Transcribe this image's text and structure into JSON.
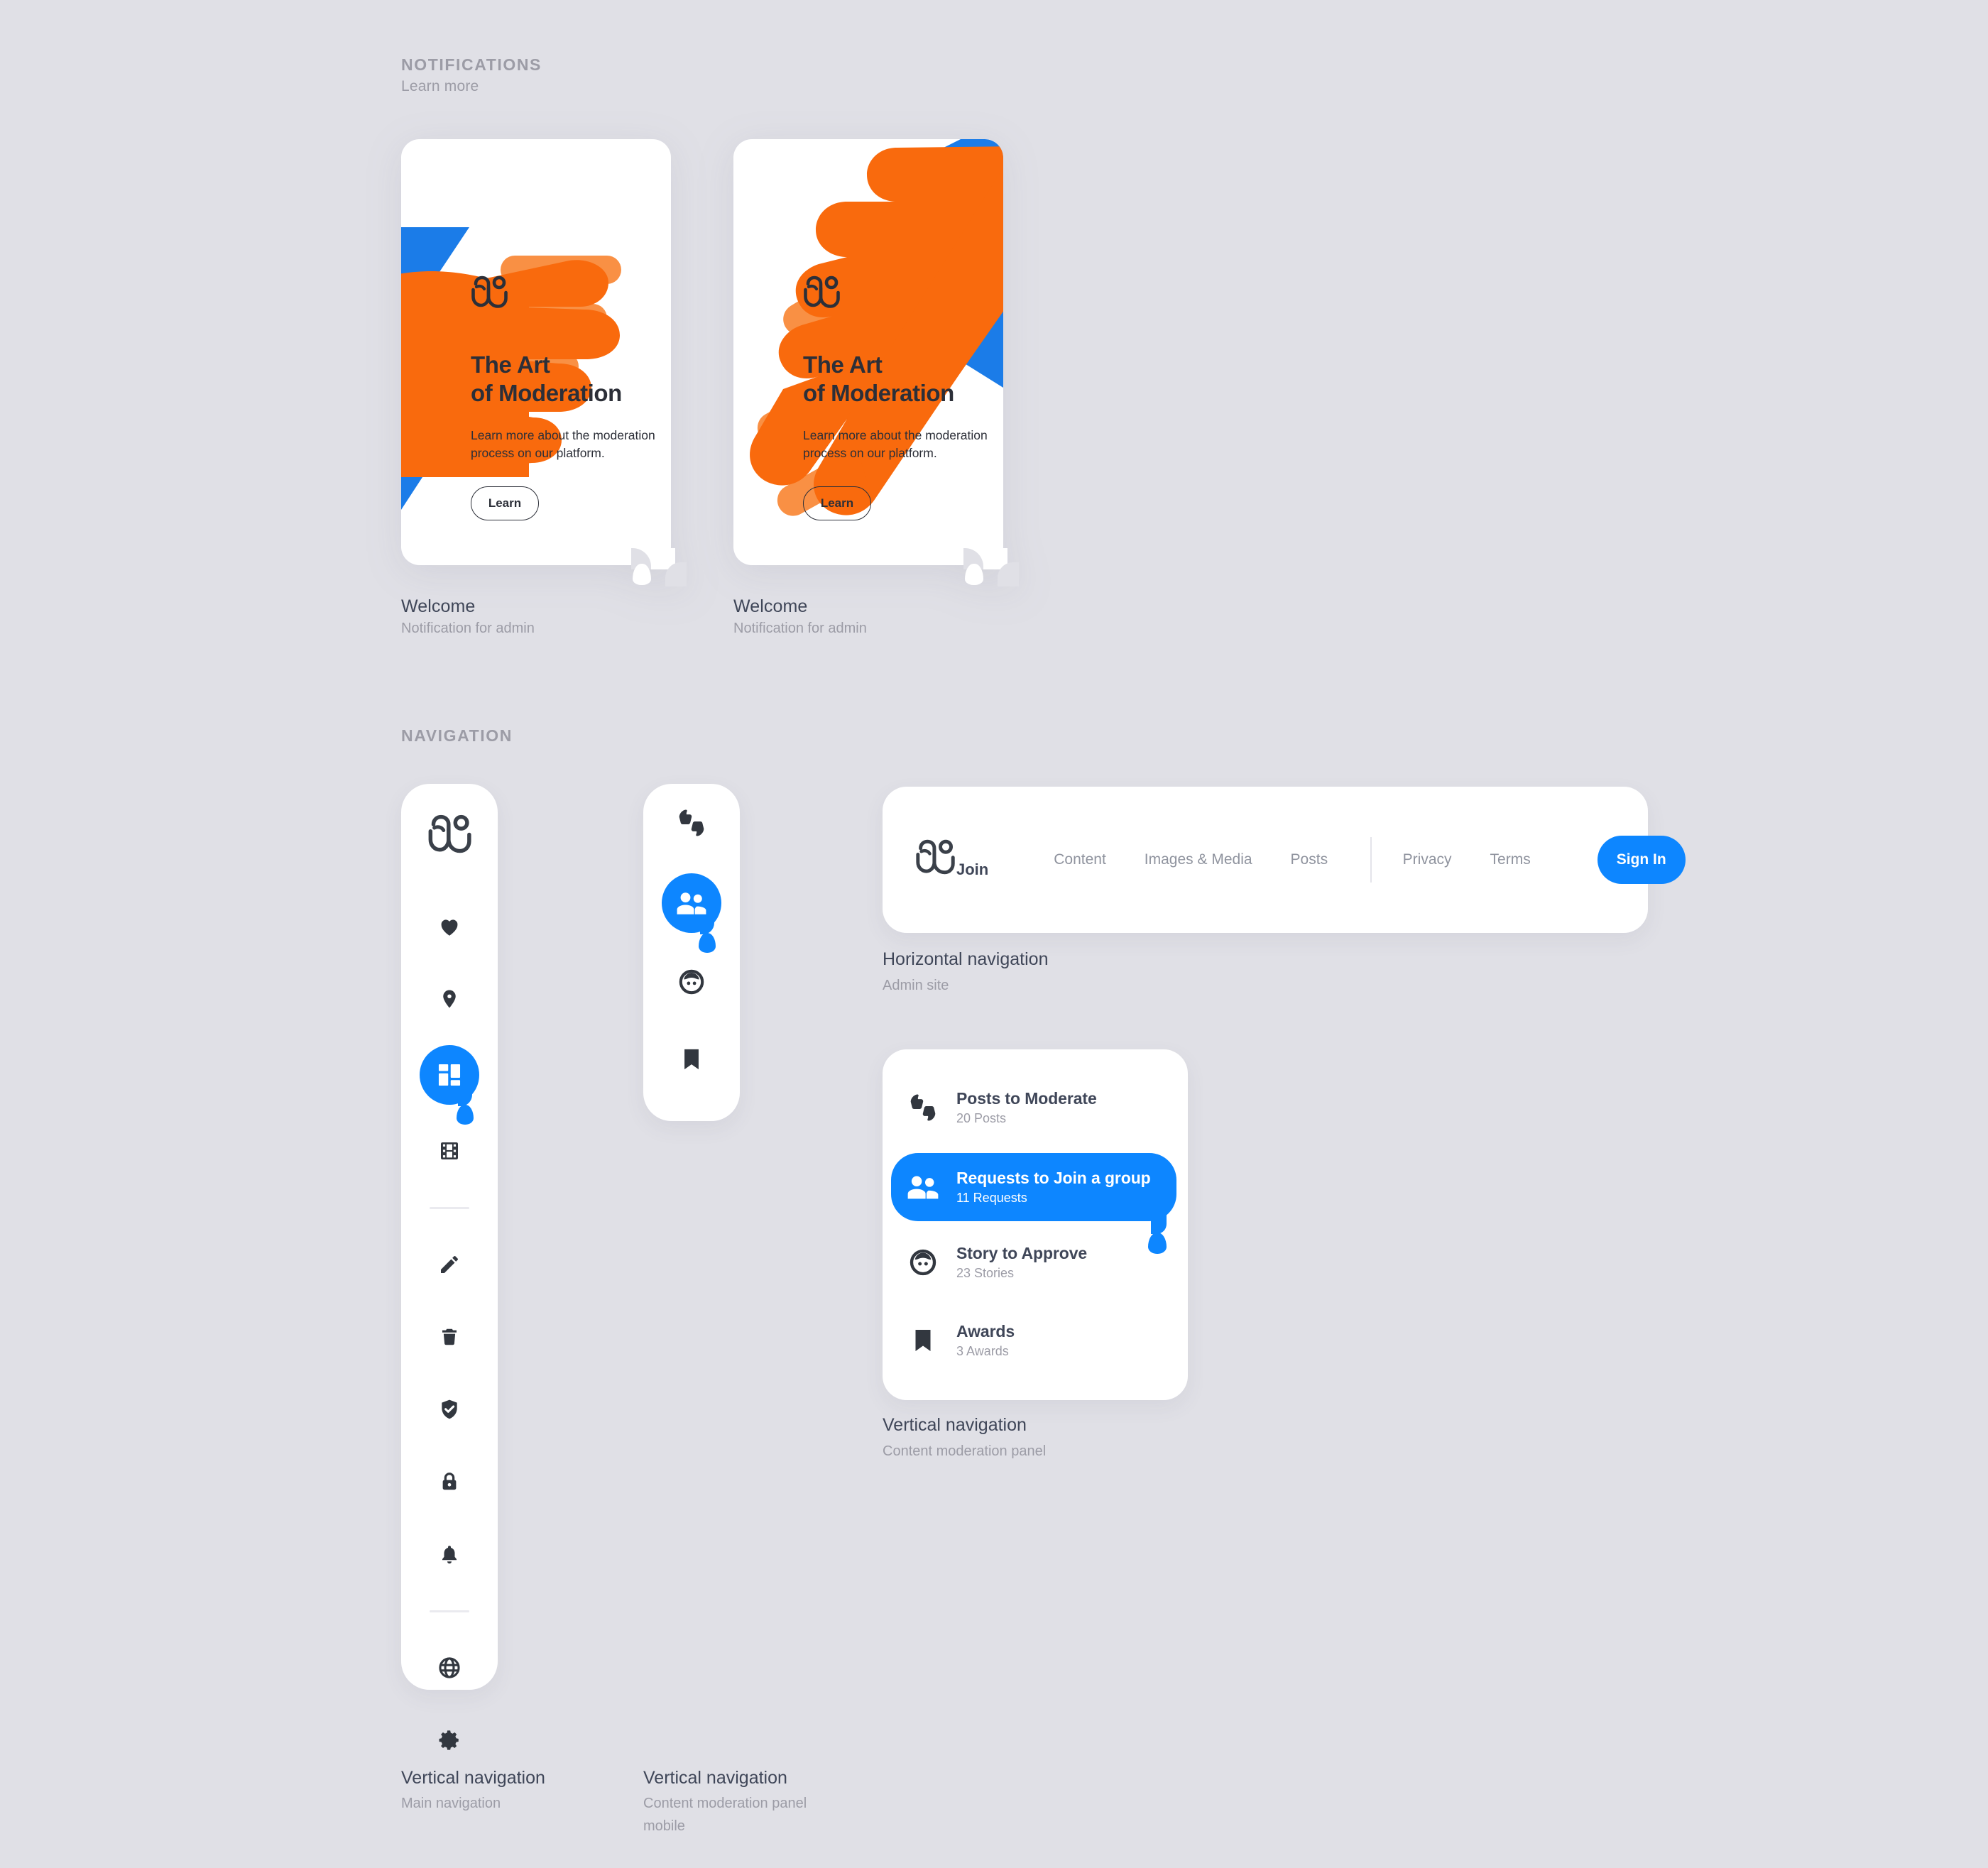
{
  "theme": {
    "background": "#e0e0e6",
    "surface": "#ffffff",
    "accent_blue": "#0d86ff",
    "art_orange": "#f96a0d",
    "art_orange_light": "#f99044",
    "art_blue": "#1b7ce8",
    "text_dark": "#2c2f38",
    "text_title": "#3f4658",
    "text_muted": "#9c9ca6"
  },
  "sections": {
    "notifications": {
      "label": "NOTIFICATIONS",
      "sublabel": "Learn more"
    },
    "navigation": {
      "label": "NAVIGATION"
    }
  },
  "notification_cards": [
    {
      "title": "The Art\nof Moderation",
      "description": "Learn more about the moderation\nprocess on our platform.",
      "button_label": "Learn",
      "caption_title": "Welcome",
      "caption_sub": "Notification for admin",
      "logo_icon": "people-logo-icon",
      "art_variant": "bottom-left-hand"
    },
    {
      "title": "The Art\nof Moderation",
      "description": "Learn more about the moderation\nprocess on our platform.",
      "button_label": "Learn",
      "caption_title": "Welcome",
      "caption_sub": "Notification for admin",
      "logo_icon": "people-logo-icon",
      "art_variant": "diagonal-hand"
    }
  ],
  "vertical_nav_main": {
    "caption_title": "Vertical navigation",
    "caption_sub": "Main navigation",
    "brand_icon": "people-logo-icon",
    "items": [
      {
        "icon": "heart-icon",
        "active": false
      },
      {
        "icon": "location-pin-icon",
        "active": false
      },
      {
        "icon": "dashboard-grid-icon",
        "active": true
      },
      {
        "icon": "film-strip-icon",
        "active": false
      },
      {
        "icon": "divider",
        "active": false
      },
      {
        "icon": "pencil-icon",
        "active": false
      },
      {
        "icon": "trash-icon",
        "active": false
      },
      {
        "icon": "shield-check-icon",
        "active": false
      },
      {
        "icon": "lock-icon",
        "active": false
      },
      {
        "icon": "bell-icon",
        "active": false
      },
      {
        "icon": "divider",
        "active": false
      },
      {
        "icon": "globe-icon",
        "active": false
      },
      {
        "icon": "gear-icon",
        "active": false
      }
    ]
  },
  "vertical_nav_mobile": {
    "caption_title": "Vertical navigation",
    "caption_sub": "Content moderation panel\nmobile",
    "items": [
      {
        "icon": "thumbs-up-down-icon",
        "active": false
      },
      {
        "icon": "people-icon",
        "active": true
      },
      {
        "icon": "face-circle-icon",
        "active": false
      },
      {
        "icon": "bookmark-icon",
        "active": false
      }
    ]
  },
  "horizontal_nav": {
    "caption_title": "Horizontal navigation",
    "caption_sub": "Admin site",
    "brand": {
      "icon": "people-logo-icon",
      "word": "Join"
    },
    "links_primary": [
      "Content",
      "Images & Media",
      "Posts"
    ],
    "links_secondary": [
      "Privacy",
      "Terms"
    ],
    "signin_label": "Sign In"
  },
  "moderation_panel": {
    "caption_title": "Vertical navigation",
    "caption_sub": "Content moderation panel",
    "rows": [
      {
        "icon": "thumbs-up-down-icon",
        "title": "Posts to Moderate",
        "sub": "20 Posts",
        "active": false
      },
      {
        "icon": "people-icon",
        "title": "Requests to Join a group",
        "sub": "11 Requests",
        "active": true
      },
      {
        "icon": "face-circle-icon",
        "title": "Story to Approve",
        "sub": "23 Stories",
        "active": false
      },
      {
        "icon": "bookmark-icon",
        "title": "Awards",
        "sub": "3 Awards",
        "active": false
      }
    ]
  }
}
